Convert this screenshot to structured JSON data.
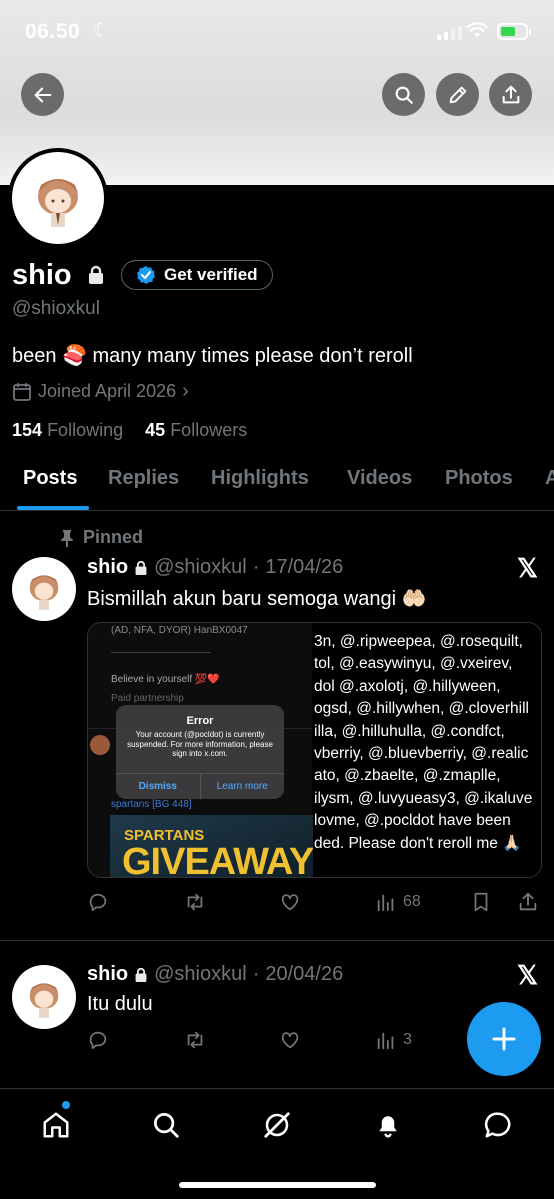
{
  "status": {
    "time": "06.50"
  },
  "profile": {
    "name": "shio",
    "verify_label": "Get verified",
    "handle": "@shioxkul",
    "bio": "been 🍣 many many times please don’t reroll",
    "joined": "Joined April 2026",
    "following_count": "154",
    "following_label": "Following",
    "followers_count": "45",
    "followers_label": "Followers"
  },
  "tabs": [
    "Posts",
    "Replies",
    "Highlights",
    "Videos",
    "Photos",
    "A"
  ],
  "posts": [
    {
      "pinned_label": "Pinned",
      "name": "shio",
      "handle": "@shioxkul",
      "date": "17/04/26",
      "text": "Bismillah akun baru semoga wangi 🤲🏻",
      "media": {
        "top_caption": "(AD, NFA, DYOR) HanBX0047",
        "believe": "Believe in yourself 💯❤️",
        "paid": "Paid partnership",
        "error_title": "Error",
        "error_msg": "Your account (@pocldot) is currently suspended. For more information, please sign into x.com.",
        "dismiss": "Dismiss",
        "learn_more": "Learn more",
        "spartans": "spartans [BG 448]",
        "giveaway_top": "SPARTANS",
        "giveaway_big": "GIVEAWAYS",
        "right_lines": [
          "3n, @.ripweepea, @.rosequilt,",
          "tol, @.easywinyu, @.vxeirev,",
          "dol @.axolotj, @.hillyween,",
          "ogsd, @.hillywhen, @.cloverhill",
          "illa, @.hilluhulla, @.condfct,",
          "vberriy, @.bluevberriy, @.realic",
          "ato, @.zbaelte, @.zmaplle,",
          "ilysm, @.luvyueasy3, @.ikaluve",
          "lovme, @.pocldot have been",
          "ded. Please don't reroll me 🙏🏻"
        ]
      },
      "views": "68"
    },
    {
      "name": "shio",
      "handle": "@shioxkul",
      "date": "20/04/26",
      "text": "Itu dulu",
      "views": "3"
    }
  ],
  "colors": {
    "accent": "#1d9bf0",
    "background": "#000000",
    "muted": "#71767b"
  }
}
